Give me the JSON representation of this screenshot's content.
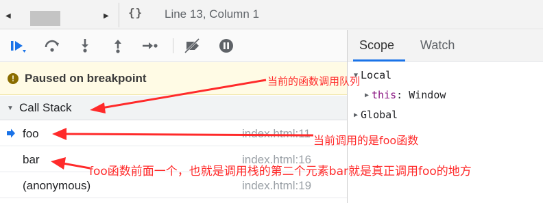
{
  "status_bar": {
    "nav_left": "◀",
    "nav_right": "▶",
    "format_icon": "{}",
    "cursor_position": "Line 13, Column 1"
  },
  "debugger": {
    "toolbar_icons": [
      "resume-icon",
      "step-over-icon",
      "step-into-icon",
      "step-out-icon",
      "step-icon",
      "deactivate-breakpoints-icon",
      "pause-on-exceptions-icon"
    ],
    "paused_message": "Paused on breakpoint",
    "call_stack": {
      "title": "Call Stack",
      "frames": [
        {
          "function": "foo",
          "location": "index.html:11",
          "current": true
        },
        {
          "function": "bar",
          "location": "index.html:16",
          "current": false
        },
        {
          "function": "(anonymous)",
          "location": "index.html:19",
          "current": false
        }
      ]
    }
  },
  "scope_pane": {
    "tabs": [
      "Scope",
      "Watch"
    ],
    "active_tab": "Scope",
    "local_label": "Local",
    "this_key": "this",
    "this_value": "Window",
    "global_label": "Global"
  },
  "annotations": {
    "call_stack_note": "当前的函数调用队列",
    "current_frame_note": "当前调用的是foo函数",
    "caller_note": "foo函数前面一个，也就是调用栈的第二个元素bar就是真正调用foo的地方"
  },
  "colors": {
    "accent": "#1a73e8",
    "annotation": "#ff2a2a",
    "paused_banner": "#fffbe5",
    "scope_key": "#881280"
  }
}
